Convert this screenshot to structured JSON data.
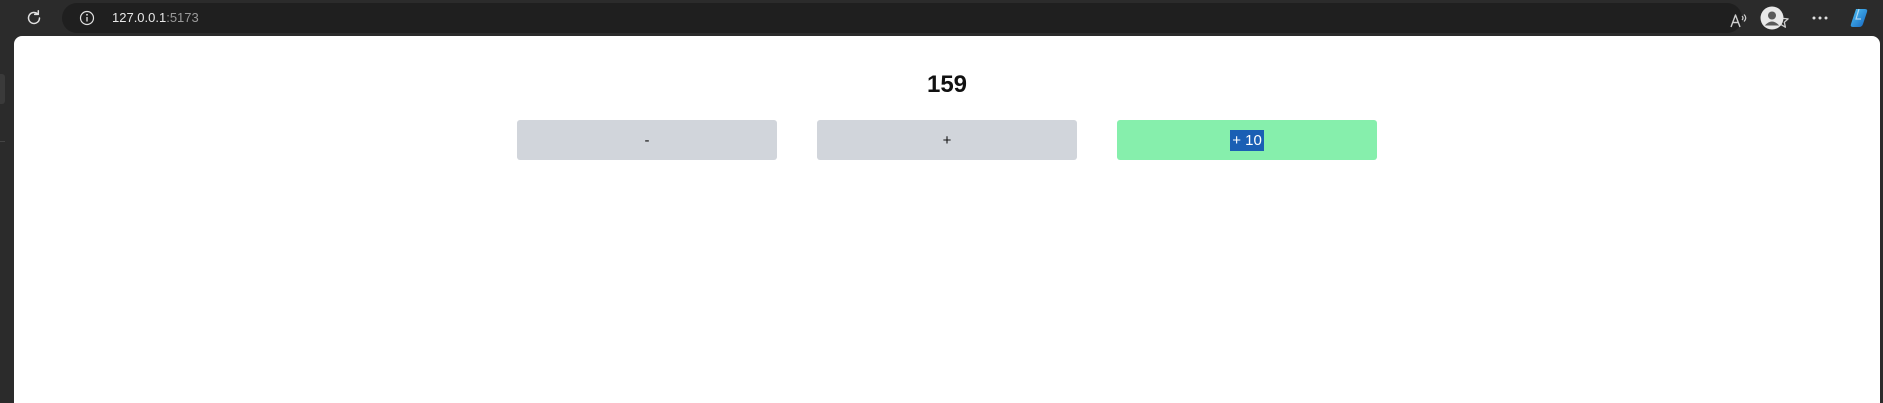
{
  "browser": {
    "url_host": "127.0.0.1",
    "url_port": ":5173"
  },
  "page": {
    "count": "159",
    "buttons": {
      "decrement_label": "-",
      "increment_label": "+",
      "increment_ten_label": "+ 10"
    }
  },
  "icons": {
    "reload": "reload-icon",
    "info": "info-icon",
    "read_aloud": "read-aloud-icon",
    "favorite": "star-icon",
    "profile": "profile-icon",
    "more": "more-icon",
    "copilot": "copilot-icon"
  },
  "colors": {
    "decrement_button": "#d1d5db",
    "increment_button": "#d1d5db",
    "increment_ten_button": "#86efac",
    "selection_highlight": "#1a5fb4"
  }
}
